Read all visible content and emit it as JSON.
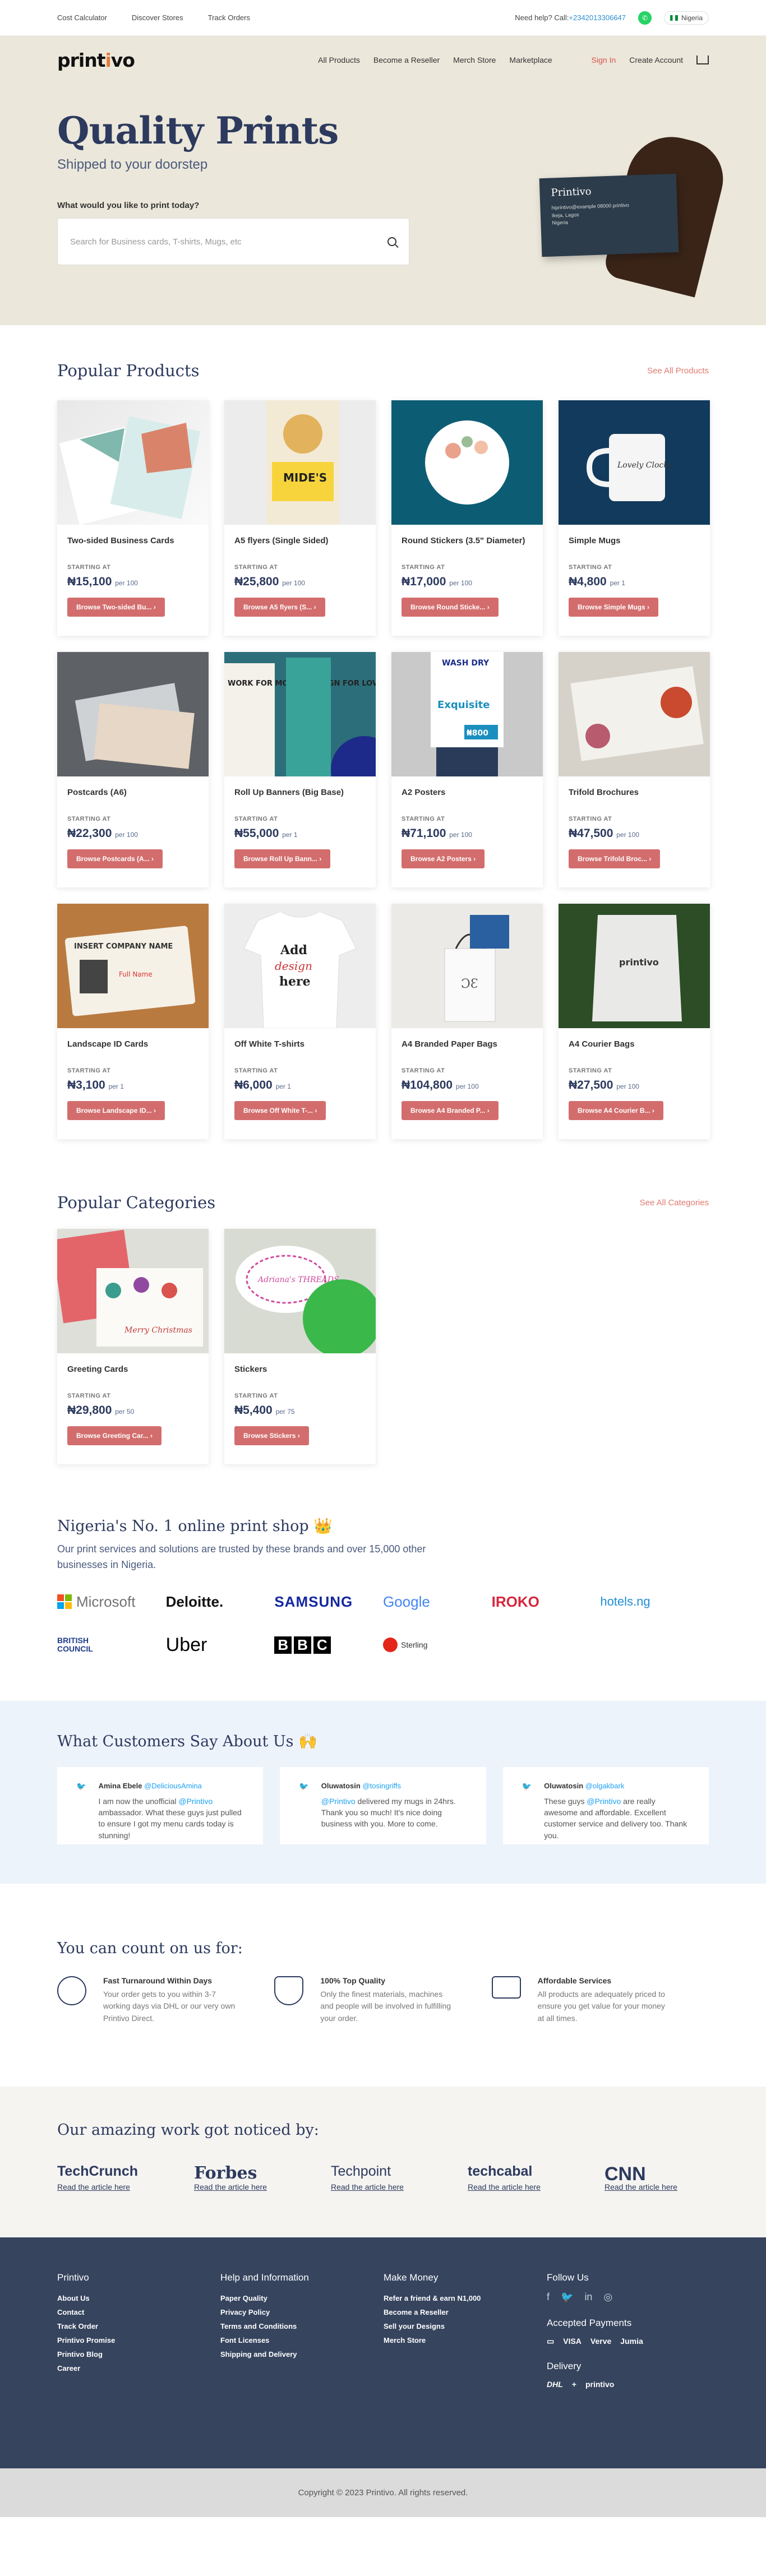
{
  "topbar": {
    "links": [
      "Cost Calculator",
      "Discover Stores",
      "Track Orders"
    ],
    "help_label": "Need help? Call:",
    "phone": "+2342013306647",
    "country": "Nigeria"
  },
  "brand": {
    "logo_pre": "print",
    "logo_i": "i",
    "logo_post": "vo"
  },
  "nav": {
    "items": [
      "All Products",
      "Become a Reseller",
      "Merch Store",
      "Marketplace"
    ],
    "signin": "Sign In",
    "create": "Create Account"
  },
  "hero": {
    "title": "Quality Prints",
    "subtitle": "Shipped to your doorstep",
    "question": "What would you like to print today?",
    "search_placeholder": "Search for Business cards, T-shirts, Mugs, etc",
    "card_name": "Printivo",
    "card_line1": "hiprintivo@example 08000 printivo",
    "card_line2": "Ikeja, Lagos",
    "card_line3": "Nigeria"
  },
  "popular": {
    "title": "Popular Products",
    "see_all": "See All Products",
    "starting": "STARTING AT",
    "items": [
      {
        "title": "Two-sided Business Cards",
        "price": "₦15,100",
        "unit": "per 100",
        "button": "Browse Two-sided Bu..."
      },
      {
        "title": "A5 flyers (Single Sided)",
        "price": "₦25,800",
        "unit": "per 100",
        "button": "Browse A5 flyers (S..."
      },
      {
        "title": "Round Stickers (3.5\" Diameter)",
        "price": "₦17,000",
        "unit": "per 100",
        "button": "Browse Round Sticke..."
      },
      {
        "title": "Simple Mugs",
        "price": "₦4,800",
        "unit": "per 1",
        "button": "Browse Simple Mugs"
      },
      {
        "title": "Postcards (A6)",
        "price": "₦22,300",
        "unit": "per 100",
        "button": "Browse Postcards (A..."
      },
      {
        "title": "Roll Up Banners (Big Base)",
        "price": "₦55,000",
        "unit": "per 1",
        "button": "Browse Roll Up Bann..."
      },
      {
        "title": "A2 Posters",
        "price": "₦71,100",
        "unit": "per 100",
        "button": "Browse A2 Posters"
      },
      {
        "title": "Trifold Brochures",
        "price": "₦47,500",
        "unit": "per 100",
        "button": "Browse Trifold Broc..."
      },
      {
        "title": "Landscape ID Cards",
        "price": "₦3,100",
        "unit": "per 1",
        "button": "Browse Landscape ID..."
      },
      {
        "title": "Off White T-shirts",
        "price": "₦6,000",
        "unit": "per 1",
        "button": "Browse Off White T-..."
      },
      {
        "title": "A4 Branded Paper Bags",
        "price": "₦104,800",
        "unit": "per 100",
        "button": "Browse A4 Branded P..."
      },
      {
        "title": "A4 Courier Bags",
        "price": "₦27,500",
        "unit": "per 100",
        "button": "Browse A4 Courier B..."
      }
    ],
    "img_text": {
      "mug": "Lovely Clocks",
      "rollup": "WORK FOR MONEY, DESIGN FOR LOVE",
      "poster_a": "WASH DRY",
      "poster_b": "Exquisite",
      "poster_c": "₦800",
      "id_head": "INSERT COMPANY NAME",
      "id_name": "Full Name",
      "tee": "Add your design here",
      "courier": "printivo"
    }
  },
  "categories": {
    "title": "Popular Categories",
    "see_all": "See All Categories",
    "items": [
      {
        "title": "Greeting Cards",
        "price": "₦29,800",
        "unit": "per 50",
        "button": "Browse Greeting Car..."
      },
      {
        "title": "Stickers",
        "price": "₦5,400",
        "unit": "per 75",
        "button": "Browse Stickers"
      }
    ],
    "img_text": {
      "xmas": "Merry Christmas",
      "sticker": "Adriana's THREADS"
    }
  },
  "trusted": {
    "title": "Nigeria's No. 1 online print shop 👑",
    "desc": "Our print services and solutions are trusted by these brands and over 15,000 other businesses in Nigeria.",
    "brands": [
      "Microsoft",
      "Deloitte.",
      "SAMSUNG",
      "Google",
      "IROKO",
      "hotels.ng",
      "BRITISH COUNCIL",
      "Uber",
      "BBC",
      "Sterling"
    ]
  },
  "testimonials": {
    "title": "What Customers Say About Us 🙌",
    "items": [
      {
        "name": "Amina Ebele",
        "handle": "@DeliciousAmina",
        "pre": "I am now the unofficial ",
        "mention": "@Printivo",
        "post": " ambassador. What these guys just pulled to ensure I got my menu cards today is stunning!"
      },
      {
        "name": "Oluwatosin",
        "handle": "@tosingriffs",
        "pre": "",
        "mention": "@Printivo",
        "post": " delivered my mugs in 24hrs. Thank you so much! It's nice doing business with you. More to come."
      },
      {
        "name": "Oluwatosin",
        "handle": "@olgakbark",
        "pre": "These guys ",
        "mention": "@Printivo",
        "post": " are really awesome and affordable. Excellent customer service and delivery too. Thank you."
      }
    ]
  },
  "count_on": {
    "title": "You can count on us for:",
    "items": [
      {
        "title": "Fast Turnaround Within Days",
        "desc": "Your order gets to you within 3-7 working days via DHL or our very own Printivo Direct."
      },
      {
        "title": "100% Top Quality",
        "desc": "Only the finest materials, machines and people will be involved in fulfilling your order."
      },
      {
        "title": "Affordable Services",
        "desc": "All products are adequately priced to ensure you get value for your money at all times."
      }
    ]
  },
  "noticed": {
    "title": "Our amazing work got noticed by:",
    "read": "Read the article here",
    "outlets": [
      "TechCrunch",
      "Forbes",
      "Techpoint",
      "techcabal",
      "CNN"
    ]
  },
  "footer": {
    "cols": [
      {
        "title": "Printivo",
        "links": [
          "About Us",
          "Contact",
          "Track Order",
          "Printivo Promise",
          "Printivo Blog",
          "Career"
        ]
      },
      {
        "title": "Help and Information",
        "links": [
          "Paper Quality",
          "Privacy Policy",
          "Terms and Conditions",
          "Font Licenses",
          "Shipping and Delivery"
        ]
      },
      {
        "title": "Make Money",
        "links": [
          "Refer a friend & earn N1,000",
          "Become a Reseller",
          "Sell your Designs",
          "Merch Store"
        ]
      }
    ],
    "follow": "Follow Us",
    "payments_title": "Accepted Payments",
    "payments": [
      "VISA",
      "Verve",
      "Jumia"
    ],
    "delivery_title": "Delivery",
    "delivery": [
      "DHL",
      "printivo"
    ],
    "copyright": "Copyright © 2023 Printivo. All rights reserved."
  }
}
